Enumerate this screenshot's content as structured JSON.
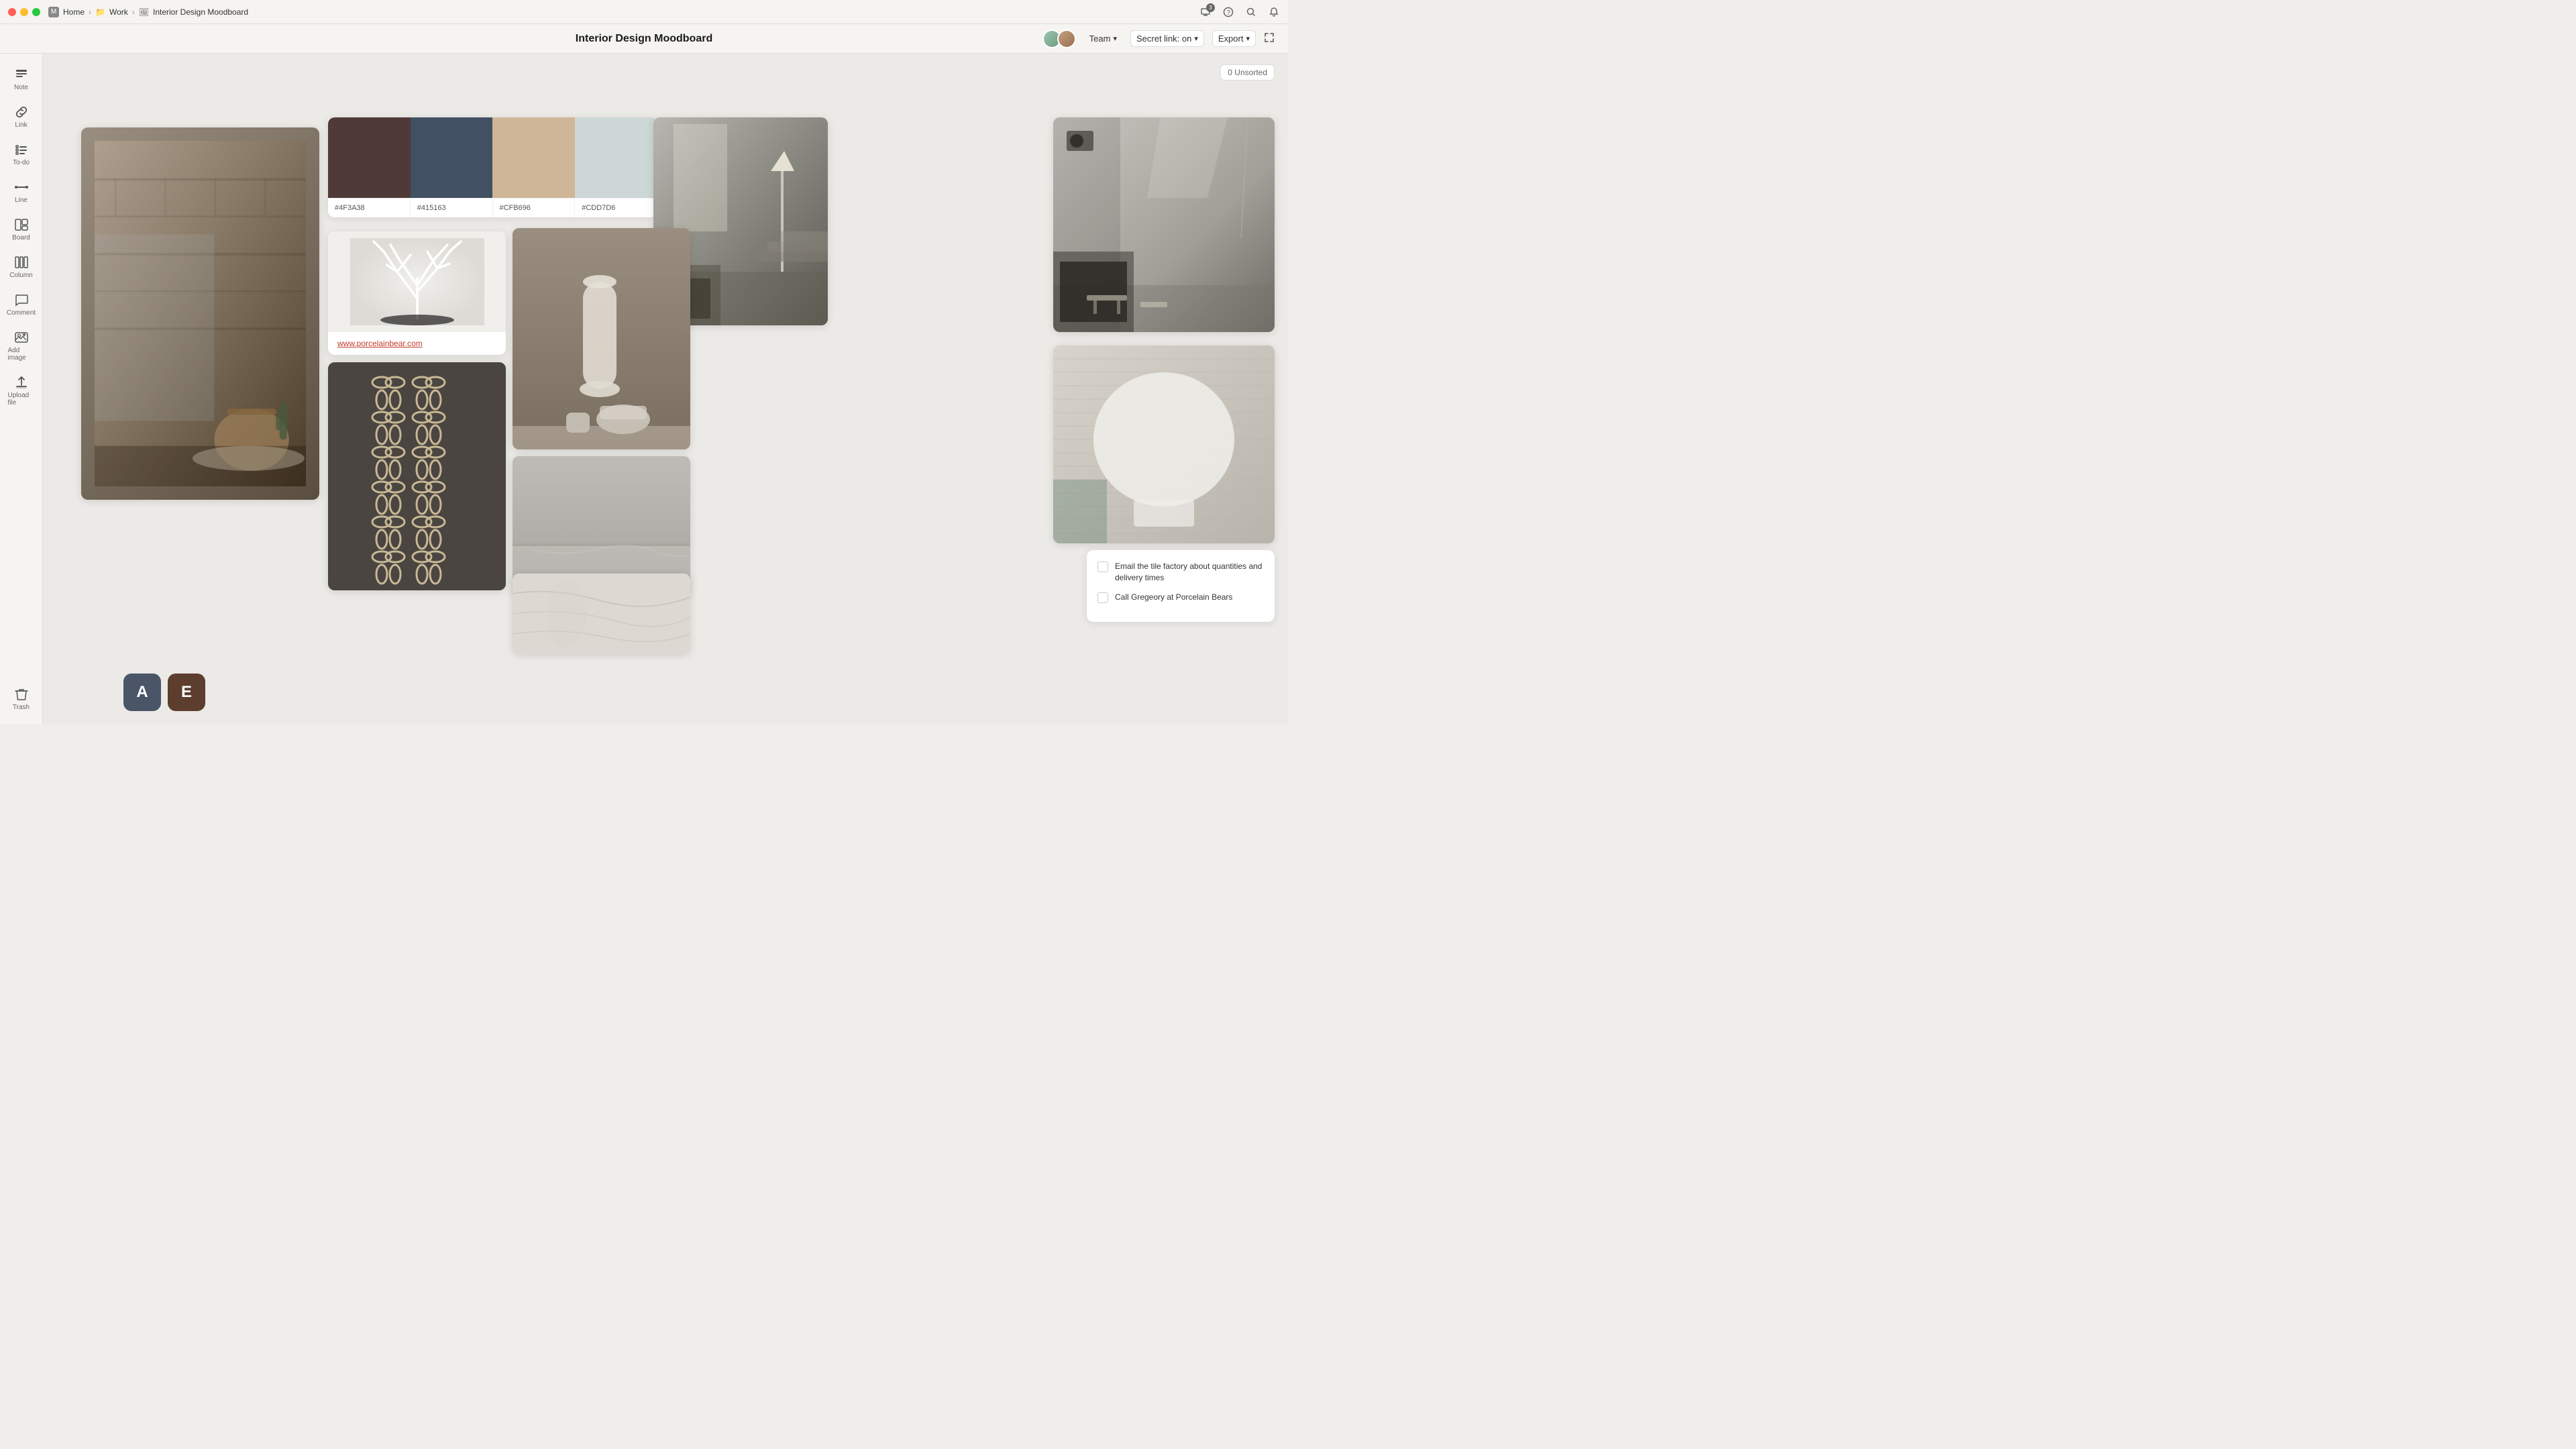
{
  "titlebar": {
    "breadcrumb": [
      "Home",
      "Work",
      "Interior Design Moodboard"
    ],
    "icons": {
      "screen": "⊡",
      "help": "?",
      "search": "🔍",
      "bell": "🔔",
      "badge_count": "3"
    }
  },
  "topbar": {
    "title": "Interior Design Moodboard",
    "team_label": "Team",
    "secret_link_label": "Secret link: on",
    "export_label": "Export",
    "unsorted_label": "0 Unsorted"
  },
  "sidebar": {
    "items": [
      {
        "id": "note",
        "icon": "≡",
        "label": "Note"
      },
      {
        "id": "link",
        "icon": "🔗",
        "label": "Link"
      },
      {
        "id": "todo",
        "icon": "☰",
        "label": "To-do"
      },
      {
        "id": "line",
        "icon": "—",
        "label": "Line"
      },
      {
        "id": "board",
        "icon": "⊞",
        "label": "Board"
      },
      {
        "id": "column",
        "icon": "▥",
        "label": "Column"
      },
      {
        "id": "comment",
        "icon": "💬",
        "label": "Comment"
      },
      {
        "id": "add-image",
        "icon": "🖼",
        "label": "Add image"
      },
      {
        "id": "upload-file",
        "icon": "⬆",
        "label": "Upload file"
      }
    ],
    "trash": {
      "icon": "🗑",
      "label": "Trash"
    }
  },
  "palette": {
    "colors": [
      "#4F3A38",
      "#415163",
      "#CFB696",
      "#CDD7D6"
    ],
    "labels": [
      "#4F3A38",
      "#415163",
      "#CFB696",
      "#CDD7D6"
    ]
  },
  "link_card": {
    "url": "www.porcelainbear.com"
  },
  "todo": {
    "items": [
      {
        "text": "Email the tile factory about quantities and delivery times",
        "checked": false
      },
      {
        "text": "Call Gregeory at Porcelain Bears",
        "checked": false
      }
    ]
  },
  "users": [
    {
      "letter": "A",
      "color": "#4a5568"
    },
    {
      "letter": "E",
      "color": "#5c3d2e"
    }
  ]
}
